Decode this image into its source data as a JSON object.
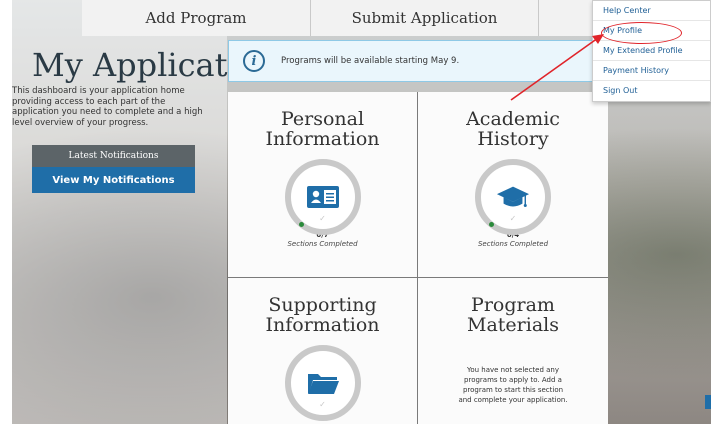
{
  "tabs": [
    {
      "label": "Add Program"
    },
    {
      "label": "Submit Application"
    },
    {
      "label": ""
    }
  ],
  "header": {
    "title": "My Application",
    "description": "This dashboard is your application home providing access to each part of the application you need to complete and a high level overview of your progress."
  },
  "notifications": {
    "heading": "Latest Notifications",
    "button_label": "View My Notifications"
  },
  "banner": {
    "text": "Programs will be available starting May 9."
  },
  "cards": {
    "personal": {
      "title_line1": "Personal",
      "title_line2": "Information",
      "count": "0/7",
      "sub": "Sections Completed",
      "icon": "id-card-icon"
    },
    "academic": {
      "title_line1": "Academic",
      "title_line2": "History",
      "count": "0/4",
      "sub": "Sections Completed",
      "icon": "graduation-cap-icon"
    },
    "supporting": {
      "title_line1": "Supporting",
      "title_line2": "Information",
      "icon": "folder-icon"
    },
    "materials": {
      "title_line1": "Program",
      "title_line2": "Materials",
      "text": "You have not selected any programs to apply to. Add a program to start this section and complete your application."
    }
  },
  "menu": {
    "items": [
      {
        "label": "Help Center"
      },
      {
        "label": "My Profile"
      },
      {
        "label": "My Extended Profile"
      },
      {
        "label": "Payment History"
      },
      {
        "label": "Sign Out"
      }
    ]
  },
  "colors": {
    "accent_blue": "#1f6ea8",
    "annotation_red": "#e0242a",
    "progress_green": "#2a8a3a"
  }
}
